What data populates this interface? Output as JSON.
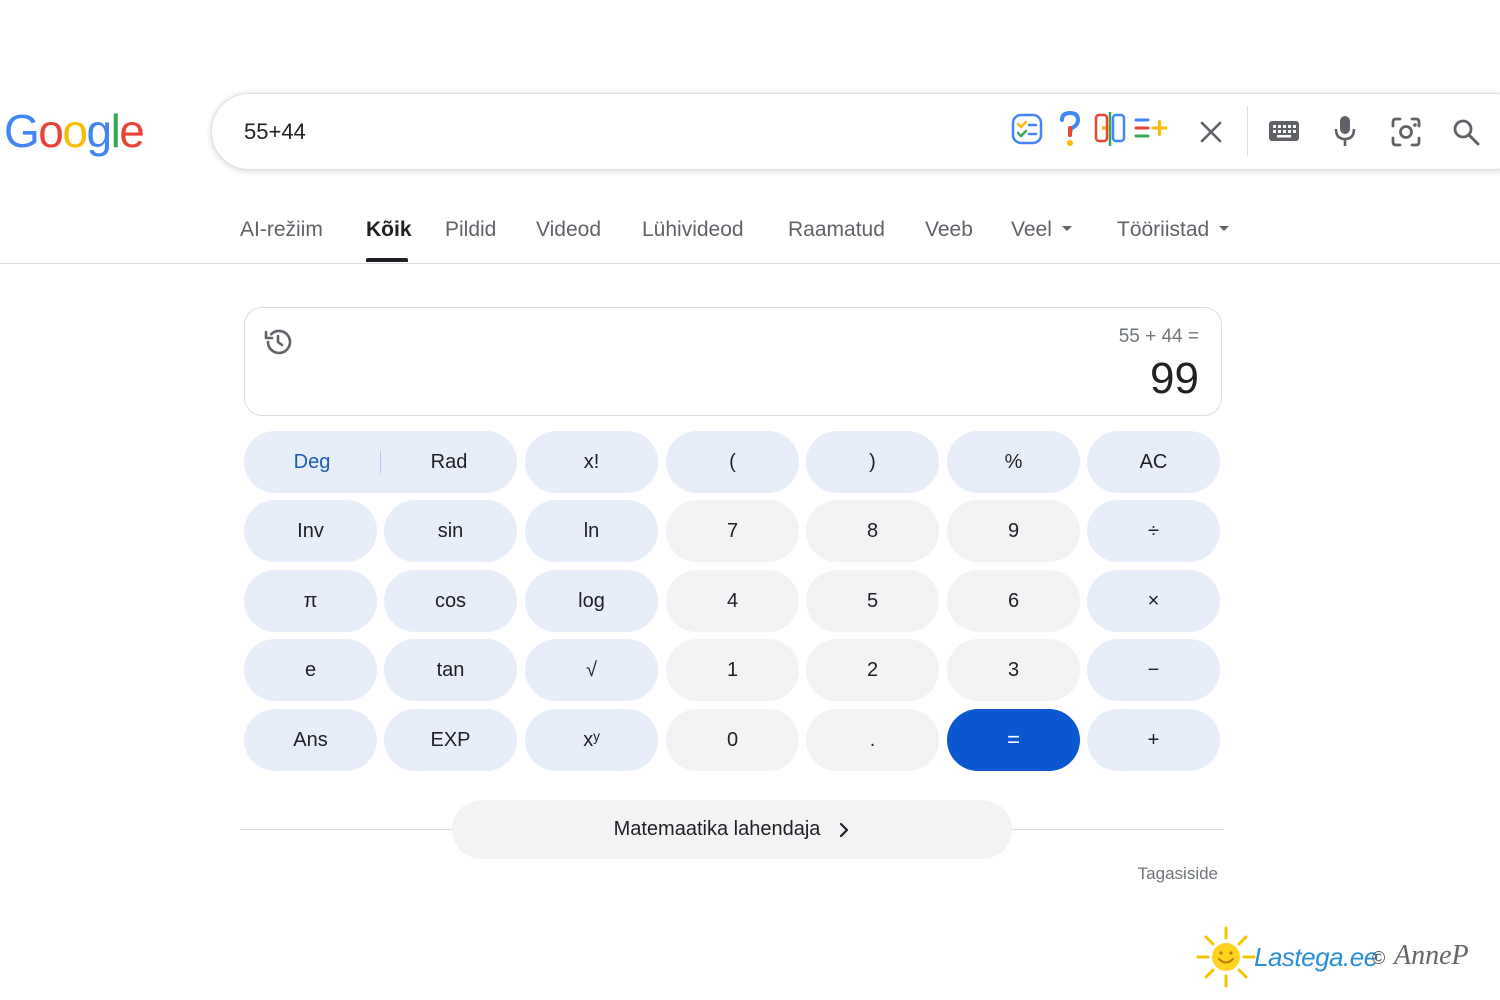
{
  "logo": {
    "letters": [
      "G",
      "o",
      "o",
      "g",
      "l",
      "e"
    ],
    "colors": [
      "#4285F4",
      "#EA4335",
      "#FBBC05",
      "#4285F4",
      "#34A853",
      "#EA4335"
    ]
  },
  "search": {
    "value": "55+44"
  },
  "tabs": [
    {
      "label": "AI-režiim",
      "active": false
    },
    {
      "label": "Kõik",
      "active": true
    },
    {
      "label": "Pildid",
      "active": false
    },
    {
      "label": "Videod",
      "active": false
    },
    {
      "label": "Lühivideod",
      "active": false
    },
    {
      "label": "Raamatud",
      "active": false
    },
    {
      "label": "Veeb",
      "active": false
    },
    {
      "label": "Veel",
      "active": false,
      "dropdown": true
    },
    {
      "label": "Tööriistad",
      "active": false,
      "dropdown": true
    }
  ],
  "calculator": {
    "expression": "55 + 44 =",
    "result": "99",
    "angle": {
      "deg": "Deg",
      "rad": "Rad"
    },
    "keys": [
      [
        "x!",
        "(",
        ")",
        "%",
        "AC"
      ],
      [
        "Inv",
        "sin",
        "ln",
        "7",
        "8",
        "9",
        "÷"
      ],
      [
        "π",
        "cos",
        "log",
        "4",
        "5",
        "6",
        "×"
      ],
      [
        "e",
        "tan",
        "√",
        "1",
        "2",
        "3",
        "−"
      ],
      [
        "Ans",
        "EXP",
        "xʸ",
        "0",
        ".",
        "=",
        "+"
      ]
    ]
  },
  "solver": {
    "label": "Matemaatika lahendaja"
  },
  "feedback": "Tagasiside",
  "watermark": {
    "brand": "Lastega.ee",
    "copyright": "©",
    "author": "AnneP"
  },
  "colors": {
    "accent": "#0b57d0",
    "function_key": "#e8edfa",
    "number_key": "#f1f3f4"
  }
}
